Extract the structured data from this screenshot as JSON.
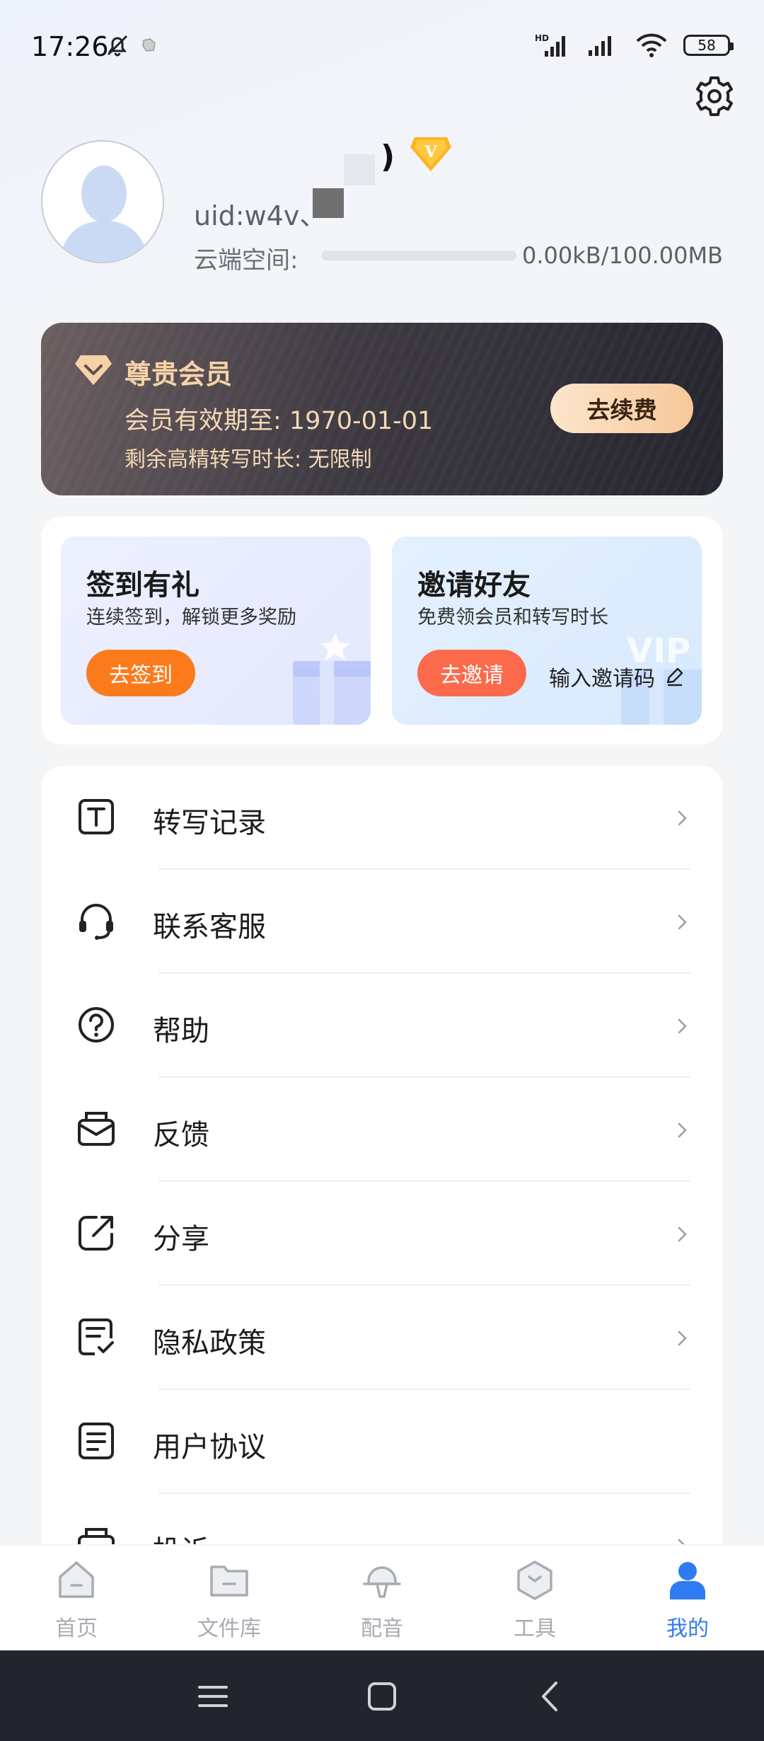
{
  "status_bar": {
    "time": "17:26",
    "signal_label": "HD",
    "battery": "58"
  },
  "profile": {
    "name_suffix": ")",
    "uid": "uid:w4v、",
    "uid_suffix": "、",
    "cloud_label": "云端空间:",
    "storage_text": "0.00kB/100.00MB",
    "storage_used_fraction": 0.0
  },
  "vip_card": {
    "title": "尊贵会员",
    "expiry": "会员有效期至: 1970-01-01",
    "remaining": "剩余高精转写时长: 无限制",
    "renew_button": "去续费"
  },
  "promo": {
    "checkin": {
      "title": "签到有礼",
      "subtitle": "连续签到，解锁更多奖励",
      "button": "去签到"
    },
    "invite": {
      "title": "邀请好友",
      "subtitle": "免费领会员和转写时长",
      "button": "去邀请",
      "code_link": "输入邀请码",
      "deco_text": "VIP"
    }
  },
  "menu": [
    {
      "label": "转写记录",
      "icon": "transcript-record-icon"
    },
    {
      "label": "联系客服",
      "icon": "headset-icon"
    },
    {
      "label": "帮助",
      "icon": "help-icon"
    },
    {
      "label": "反馈",
      "icon": "feedback-mail-icon"
    },
    {
      "label": "分享",
      "icon": "share-icon"
    },
    {
      "label": "隐私政策",
      "icon": "privacy-doc-icon"
    },
    {
      "label": "用户协议",
      "icon": "agreement-doc-icon"
    },
    {
      "label": "投诉",
      "icon": "complaint-icon"
    }
  ],
  "bottom_nav": [
    {
      "label": "首页",
      "icon": "home-icon",
      "active": false
    },
    {
      "label": "文件库",
      "icon": "folder-icon",
      "active": false
    },
    {
      "label": "配音",
      "icon": "dubbing-icon",
      "active": false
    },
    {
      "label": "工具",
      "icon": "tools-icon",
      "active": false
    },
    {
      "label": "我的",
      "icon": "profile-icon",
      "active": true
    }
  ],
  "colors": {
    "accent": "#2f7bf3",
    "checkin_button": "#fb7b1c",
    "invite_button": "#fb6a4b",
    "vip_gold": "#f6d2a7"
  }
}
